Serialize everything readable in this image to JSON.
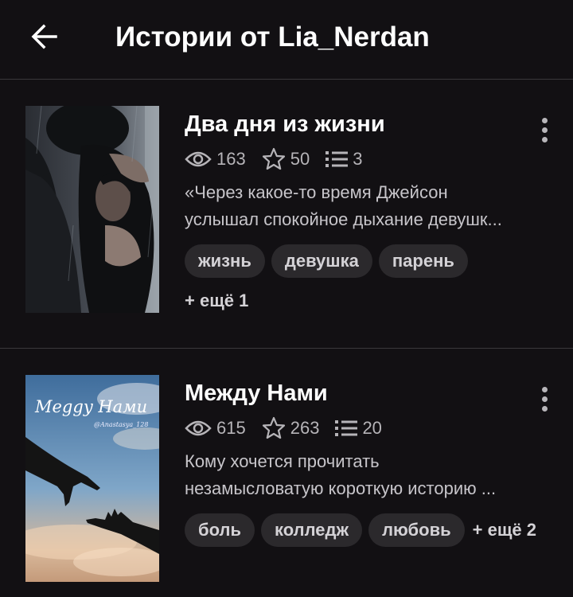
{
  "header": {
    "title": "Истории от Lia_Nerdan",
    "back_icon": "arrow-left-icon"
  },
  "stories": [
    {
      "title": "Два дня из жизни",
      "reads": "163",
      "votes": "50",
      "parts": "3",
      "description_lines": [
        "«Через какое-то время Джейсон",
        "услышал спокойное дыхание девушк..."
      ],
      "tags": [
        "жизнь",
        "девушка",
        "парень"
      ],
      "more_tags": "+ ещё 1"
    },
    {
      "title": "Между Нами",
      "reads": "615",
      "votes": "263",
      "parts": "20",
      "description_lines": [
        "Кому хочется прочитать",
        "незамысловатую короткую историю ..."
      ],
      "tags": [
        "боль",
        "колледж",
        "любовь"
      ],
      "more_tags": "+ ещё 2",
      "cover_title": "Meggy Нами",
      "cover_author": "@Anastasya_128"
    }
  ],
  "colors": {
    "background": "#121013",
    "divider": "#3a383b",
    "tag_bg": "#2b292c",
    "muted_text": "#b6b4b8"
  }
}
